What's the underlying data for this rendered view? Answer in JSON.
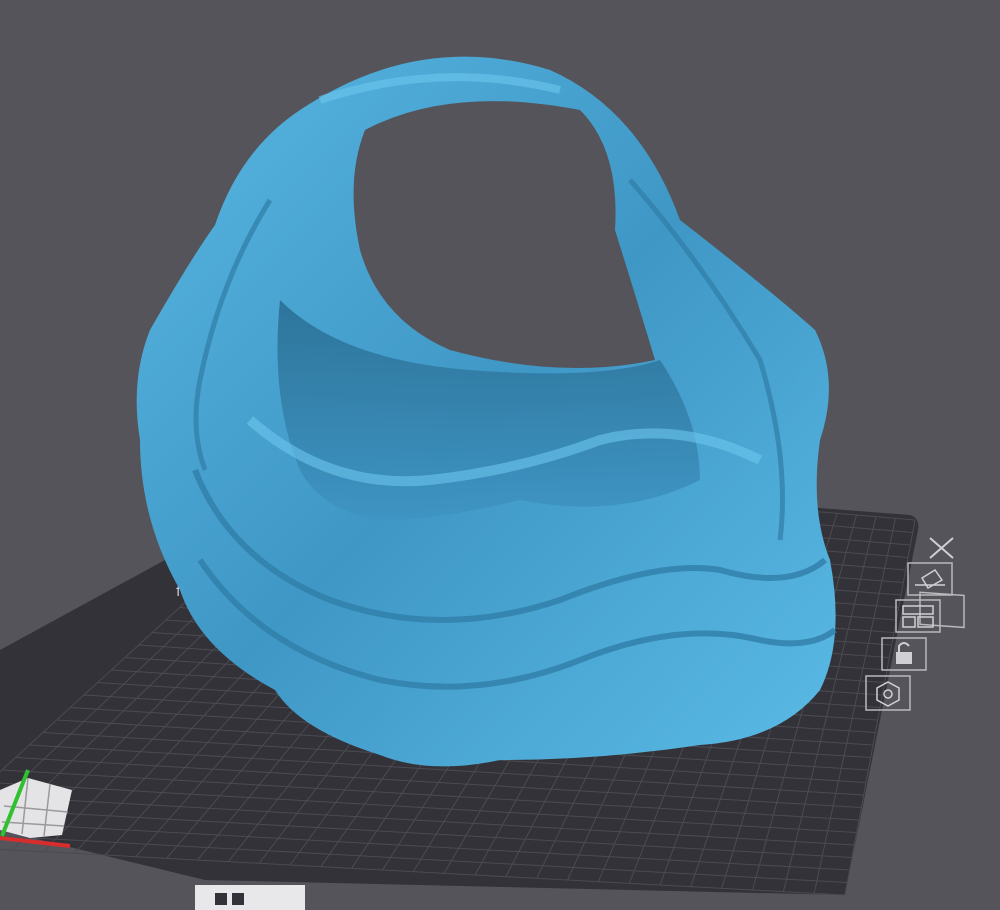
{
  "viewport": {
    "background_color": "#55545a",
    "plate_color": "#333238",
    "grid_color": "#4a4950",
    "model_color": "#49a6d4",
    "model_shadow_color": "#2f7ea7"
  },
  "plate_tools": [
    {
      "name": "close-plate-icon",
      "icon": "x"
    },
    {
      "name": "auto-orient-icon",
      "icon": "orient"
    },
    {
      "name": "arrange-plate-icon",
      "icon": "arrange"
    },
    {
      "name": "lock-plate-icon",
      "icon": "lock"
    },
    {
      "name": "plate-settings-icon",
      "icon": "hex-settings"
    }
  ],
  "axis": {
    "x_color": "#d72d2d",
    "y_color": "#2fc12f"
  }
}
